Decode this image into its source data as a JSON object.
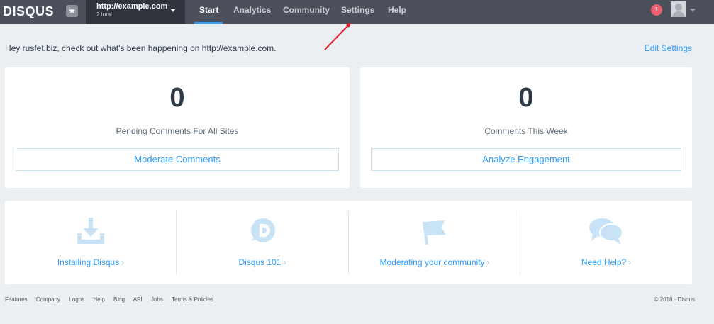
{
  "header": {
    "logo": "DISQUS",
    "site_url": "http://example.com",
    "site_total": "2 total",
    "nav": [
      "Start",
      "Analytics",
      "Community",
      "Settings",
      "Help"
    ],
    "notification_count": "1"
  },
  "greeting": "Hey rusfet.biz, check out what's been happening on http://example.com.",
  "edit_settings": "Edit Settings",
  "cards": [
    {
      "number": "0",
      "label": "Pending Comments For All Sites",
      "button": "Moderate Comments"
    },
    {
      "number": "0",
      "label": "Comments This Week",
      "button": "Analyze Engagement"
    }
  ],
  "resources": [
    {
      "label": "Installing Disqus",
      "icon": "download-icon"
    },
    {
      "label": "Disqus 101",
      "icon": "disqus-logo-icon"
    },
    {
      "label": "Moderating your community",
      "icon": "flag-icon"
    },
    {
      "label": "Need Help?",
      "icon": "chat-bubbles-icon"
    }
  ],
  "footer": {
    "links": [
      "Features",
      "Company",
      "Logos",
      "Help",
      "Blog",
      "API",
      "Jobs",
      "Terms & Policies"
    ],
    "copyright": "© 2018 · Disqus"
  },
  "colors": {
    "accent": "#2e9fff",
    "topbar": "#4b505b",
    "notification": "#f05f70",
    "icon_light": "#c9e3f6"
  }
}
